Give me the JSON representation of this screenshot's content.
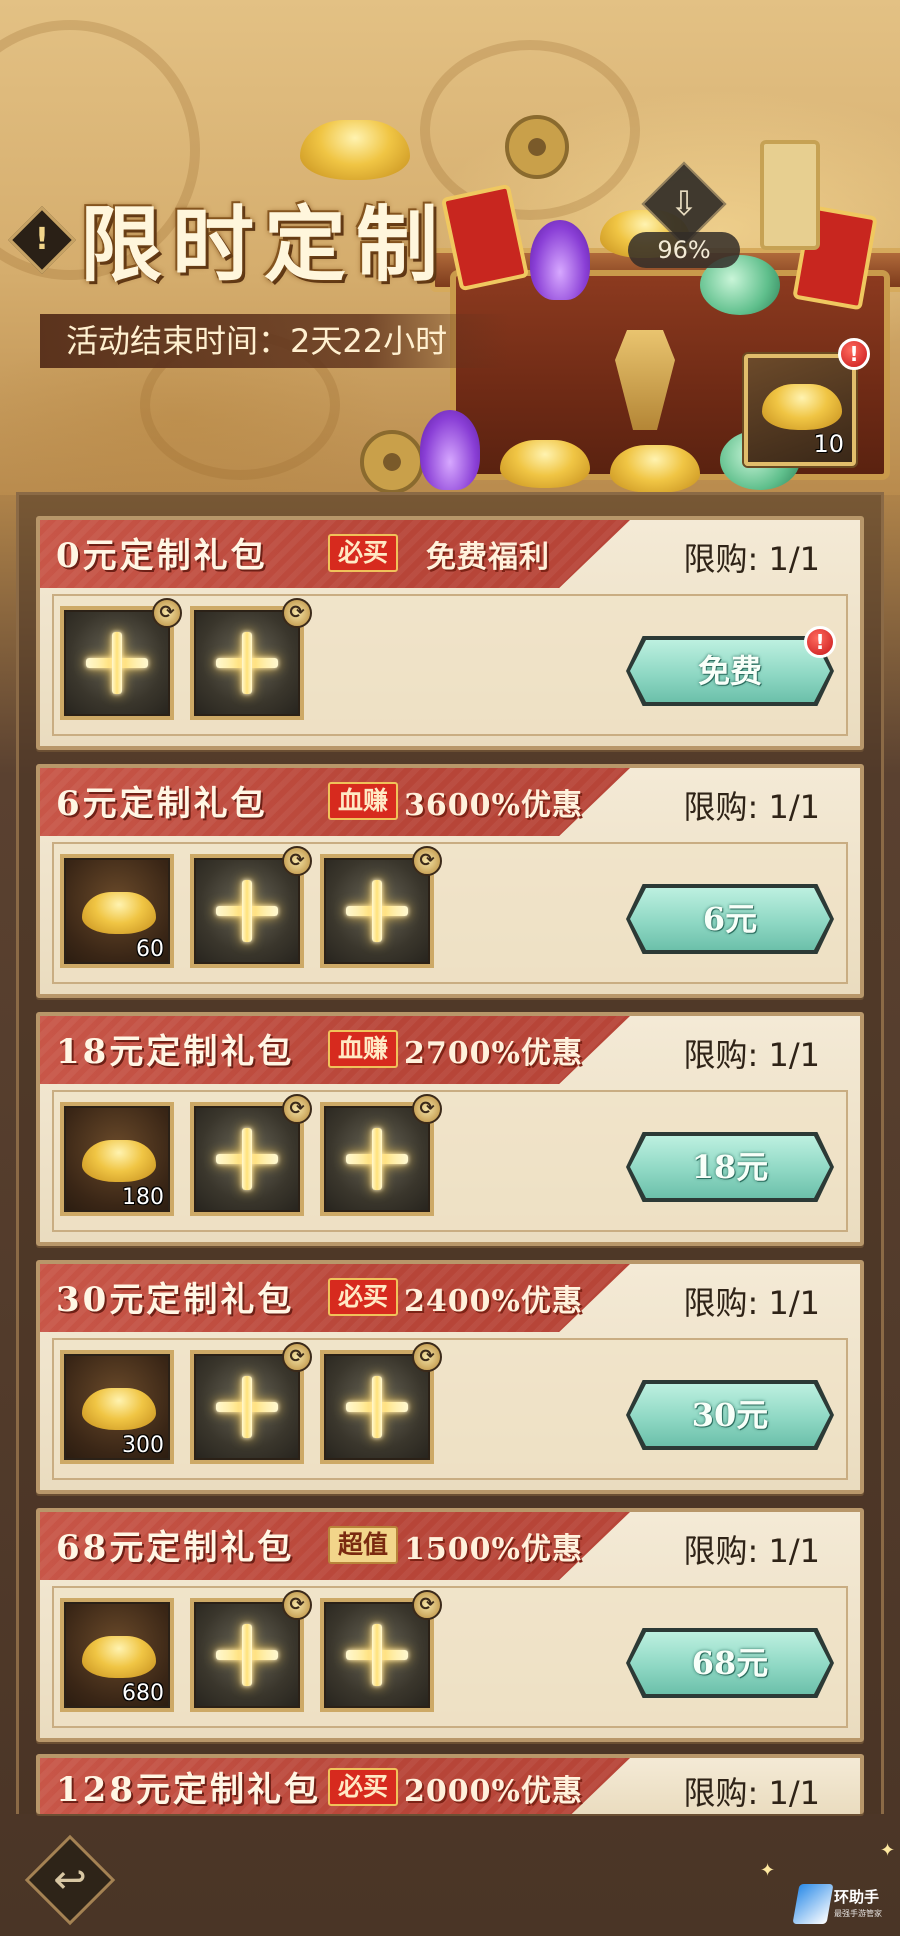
{
  "header": {
    "title": "限时定制",
    "alert_icon_glyph": "!",
    "end_time": "活动结束时间：2天22小时",
    "progress_percent": "96%",
    "progress_arrow_glyph": "⇩",
    "reward": {
      "icon": "gold-ingot-icon",
      "count": "10",
      "badge": "!"
    }
  },
  "packages": [
    {
      "title": "0元定制礼包",
      "tag": "必买",
      "tag_style": "red",
      "discount": "免费福利",
      "limit": "限购: 1/1",
      "button": "免费",
      "button_badge": "!",
      "items": [
        {
          "type": "cross",
          "swap": true
        },
        {
          "type": "cross",
          "swap": true
        }
      ]
    },
    {
      "title": "6元定制礼包",
      "tag": "血赚",
      "tag_style": "red",
      "discount": "3600%优惠",
      "limit": "限购: 1/1",
      "button": "6元",
      "items": [
        {
          "type": "ingot",
          "count": "60"
        },
        {
          "type": "cross",
          "swap": true
        },
        {
          "type": "cross",
          "swap": true
        }
      ]
    },
    {
      "title": "18元定制礼包",
      "tag": "血赚",
      "tag_style": "red",
      "discount": "2700%优惠",
      "limit": "限购: 1/1",
      "button": "18元",
      "items": [
        {
          "type": "ingot",
          "count": "180"
        },
        {
          "type": "cross",
          "swap": true
        },
        {
          "type": "cross",
          "swap": true
        }
      ]
    },
    {
      "title": "30元定制礼包",
      "tag": "必买",
      "tag_style": "red",
      "discount": "2400%优惠",
      "limit": "限购: 1/1",
      "button": "30元",
      "items": [
        {
          "type": "ingot",
          "count": "300"
        },
        {
          "type": "cross",
          "swap": true
        },
        {
          "type": "cross",
          "swap": true
        }
      ]
    },
    {
      "title": "68元定制礼包",
      "tag": "超值",
      "tag_style": "gold",
      "discount": "1500%优惠",
      "limit": "限购: 1/1",
      "button": "68元",
      "items": [
        {
          "type": "ingot",
          "count": "680"
        },
        {
          "type": "cross",
          "swap": true
        },
        {
          "type": "cross",
          "swap": true
        }
      ]
    },
    {
      "title": "128元定制礼包",
      "tag": "必买",
      "tag_style": "red",
      "discount": "2000%优惠",
      "limit": "限购: 1/1",
      "button": "",
      "items": []
    }
  ],
  "footer": {
    "back_glyph": "↩"
  },
  "watermark": {
    "name": "环助手",
    "sub": "最强手游管家"
  },
  "colors": {
    "ribbon_red": "#b74538",
    "button_teal": "#8fd8c4",
    "card_bg": "#f4ead6",
    "frame_gold": "#cda966"
  }
}
